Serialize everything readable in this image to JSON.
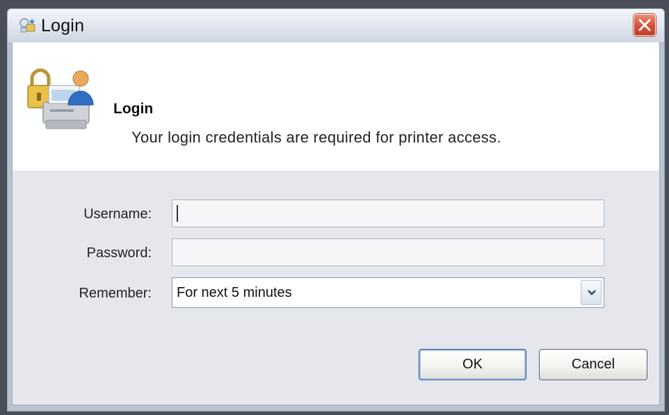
{
  "window": {
    "title": "Login"
  },
  "header": {
    "title": "Login",
    "description": "Your login credentials are required for printer access."
  },
  "form": {
    "username_label": "Username:",
    "username_value": "",
    "password_label": "Password:",
    "password_value": "",
    "remember_label": "Remember:",
    "remember_selected": "For next 5 minutes"
  },
  "buttons": {
    "ok_label": "OK",
    "cancel_label": "Cancel"
  },
  "icons": {
    "title": "login-key-icon",
    "close": "close-icon",
    "header": "printer-lock-user-icon",
    "dropdown": "chevron-down-icon"
  },
  "colors": {
    "close_button": "#d2503a",
    "titlebar": "#dfe5ee",
    "default_button_focus": "#a8c4ea"
  }
}
